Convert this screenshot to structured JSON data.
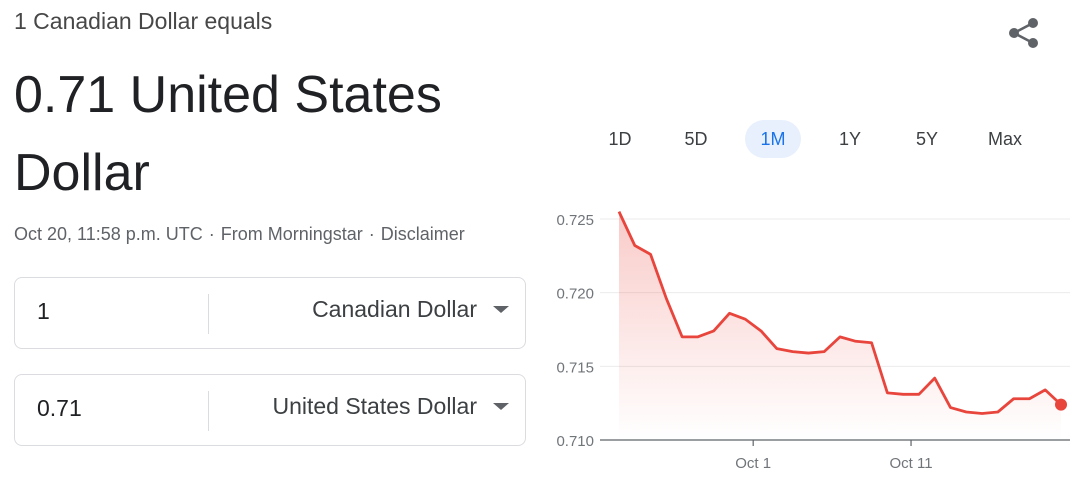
{
  "header": {
    "subtitle": "1 Canadian Dollar equals",
    "result": "0.71 United States Dollar",
    "share_icon": "share-icon"
  },
  "meta": {
    "timestamp": "Oct 20, 11:58 p.m. UTC",
    "separator": "·",
    "source": "From Morningstar",
    "disclaimer": "Disclaimer"
  },
  "converter": {
    "from": {
      "amount": "1",
      "unit": "Canadian Dollar"
    },
    "to": {
      "amount": "0.71",
      "unit": "United States Dollar"
    },
    "dropdown_icon": "caret-down-icon"
  },
  "range_tabs": [
    {
      "label": "1D"
    },
    {
      "label": "5D"
    },
    {
      "label": "1M",
      "active": true
    },
    {
      "label": "1Y"
    },
    {
      "label": "5Y"
    },
    {
      "label": "Max"
    }
  ],
  "colors": {
    "line": "#e8453c",
    "active_tab_bg": "#e8f0fe",
    "active_tab_text": "#1a73e8"
  },
  "chart_data": {
    "type": "area",
    "title": "",
    "xlabel": "",
    "ylabel": "",
    "ylim": [
      0.71,
      0.725
    ],
    "yticks": [
      "0.725",
      "0.720",
      "0.715",
      "0.710"
    ],
    "ytick_values": [
      0.725,
      0.72,
      0.715,
      0.71
    ],
    "xticks": [
      {
        "label": "Oct 1",
        "index": 8.5
      },
      {
        "label": "Oct 11",
        "index": 18.5
      }
    ],
    "grid": true,
    "series": [
      {
        "values": [
          0.7255,
          0.7232,
          0.7226,
          0.7196,
          0.717,
          0.717,
          0.7174,
          0.7186,
          0.7182,
          0.7174,
          0.7162,
          0.716,
          0.7159,
          0.716,
          0.717,
          0.7167,
          0.7166,
          0.7132,
          0.7131,
          0.7131,
          0.7142,
          0.7122,
          0.7119,
          0.7118,
          0.7119,
          0.7128,
          0.7128,
          0.7134,
          0.7124
        ]
      }
    ]
  }
}
